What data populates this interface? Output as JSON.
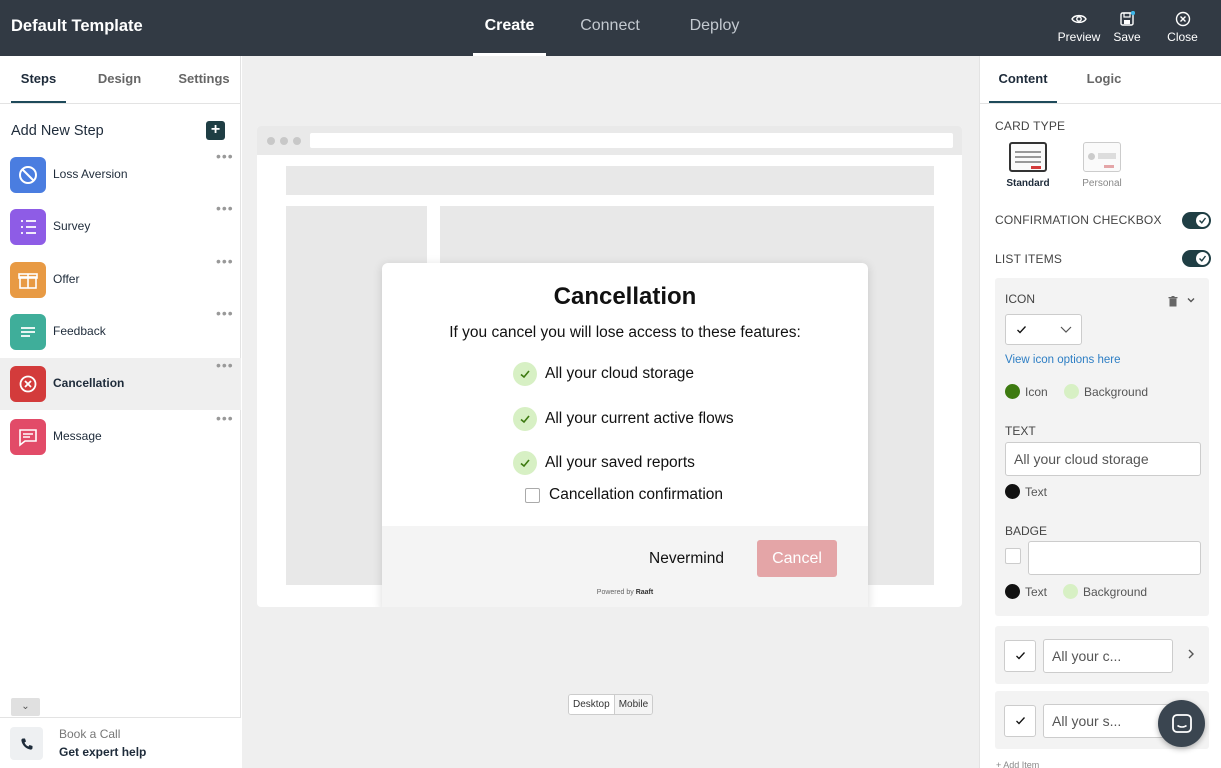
{
  "app": {
    "title": "Default Template"
  },
  "nav": {
    "create": "Create",
    "connect": "Connect",
    "deploy": "Deploy"
  },
  "actions": {
    "preview": "Preview",
    "save": "Save",
    "close": "Close"
  },
  "left": {
    "tabs": {
      "steps": "Steps",
      "design": "Design",
      "settings": "Settings"
    },
    "add_step": "Add New Step",
    "steps": [
      {
        "label": "Loss Aversion",
        "icon": "block-icon",
        "color": "#4a7de0"
      },
      {
        "label": "Survey",
        "icon": "list-icon",
        "color": "#8e5ce6"
      },
      {
        "label": "Offer",
        "icon": "gift-icon",
        "color": "#e89a44"
      },
      {
        "label": "Feedback",
        "icon": "text-lines-icon",
        "color": "#3fae9a"
      },
      {
        "label": "Cancellation",
        "icon": "x-circle-icon",
        "color": "#d33b3b"
      },
      {
        "label": "Message",
        "icon": "chat-icon",
        "color": "#e24b68"
      }
    ],
    "book": {
      "line1": "Book a Call",
      "line2": "Get expert help"
    }
  },
  "modal": {
    "title": "Cancellation",
    "subtitle": "If you cancel you will lose access to these features:",
    "features": [
      "All your cloud storage",
      "All your current active flows",
      "All your saved reports"
    ],
    "confirmation": "Cancellation confirmation",
    "nevermind": "Nevermind",
    "cancel": "Cancel",
    "powered_by": "Powered by",
    "brand": "Raaft"
  },
  "device": {
    "desktop": "Desktop",
    "mobile": "Mobile"
  },
  "right": {
    "tabs": {
      "content": "Content",
      "logic": "Logic"
    },
    "card_type_label": "CARD TYPE",
    "card_types": {
      "standard": "Standard",
      "personal": "Personal"
    },
    "confirmation_checkbox_label": "CONFIRMATION CHECKBOX",
    "list_items_label": "LIST ITEMS",
    "icon_section": {
      "label": "ICON",
      "link": "View icon options here",
      "icon_swatch": "Icon",
      "background_swatch": "Background",
      "icon_color": "#3d7a10",
      "background_color": "#d7f0c4"
    },
    "text_section": {
      "label": "TEXT",
      "value": "All your cloud storage",
      "text_swatch": "Text"
    },
    "badge_section": {
      "label": "BADGE",
      "text_swatch": "Text",
      "background_swatch": "Background"
    },
    "list_rows": [
      {
        "value": "All your c..."
      },
      {
        "value": "All your s..."
      }
    ],
    "add_item": "+ Add Item"
  }
}
